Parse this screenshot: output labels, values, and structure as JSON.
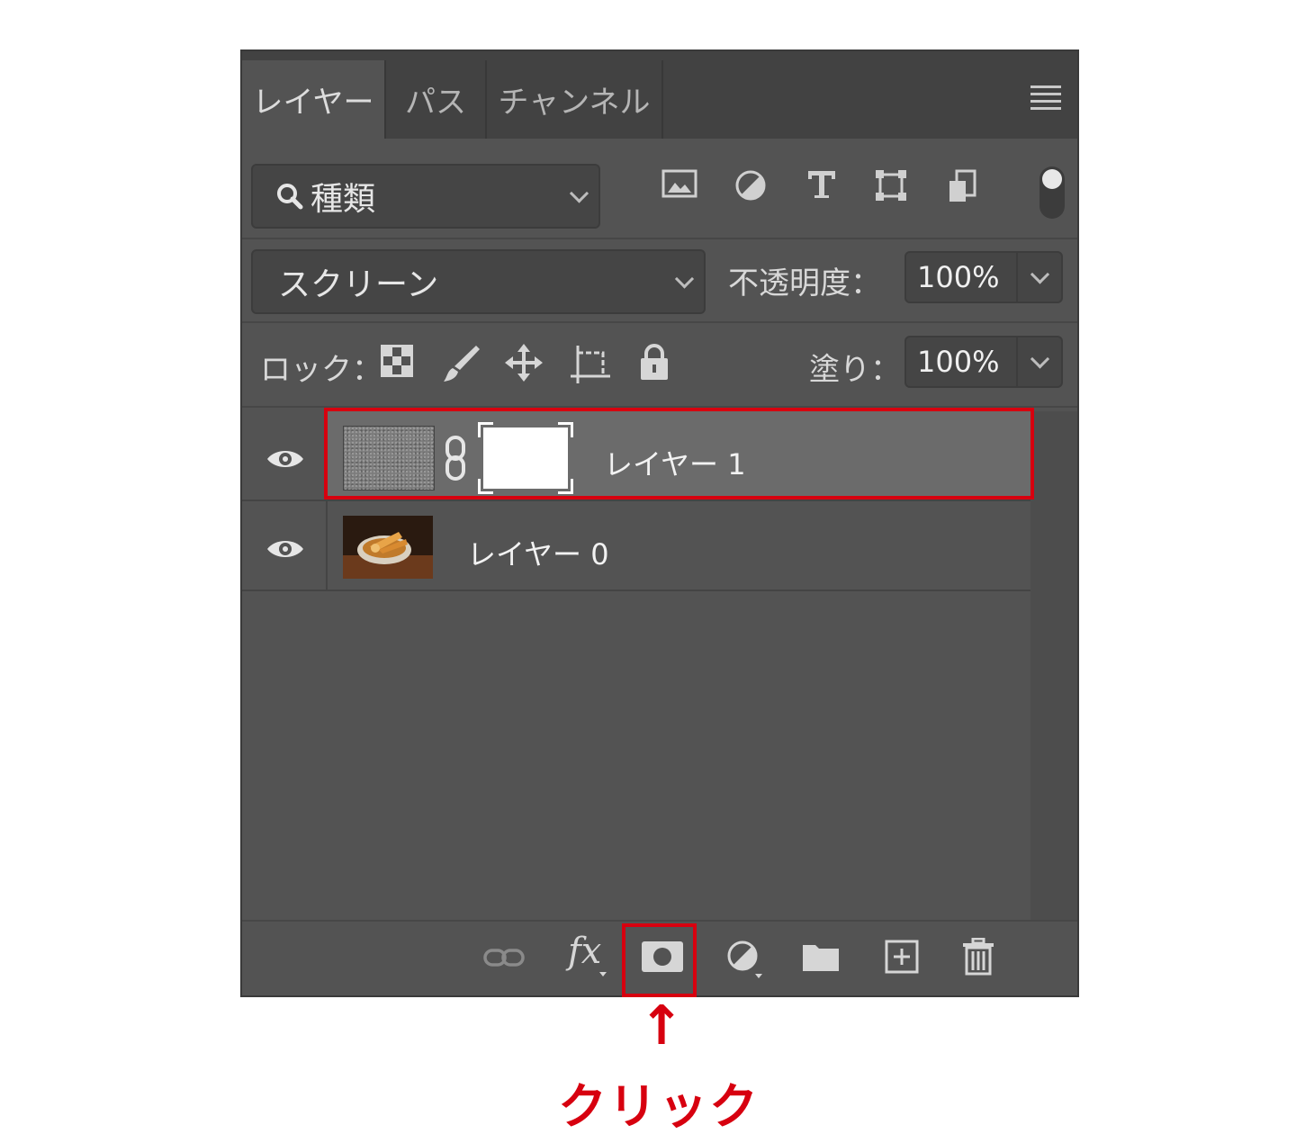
{
  "tabs": [
    {
      "label": "レイヤー",
      "active": true
    },
    {
      "label": "パス",
      "active": false
    },
    {
      "label": "チャンネル",
      "active": false
    }
  ],
  "filter": {
    "label": "種類"
  },
  "blend_mode": {
    "value": "スクリーン"
  },
  "opacity": {
    "label": "不透明度：",
    "value": "100%"
  },
  "lock": {
    "label": "ロック："
  },
  "fill": {
    "label": "塗り：",
    "value": "100%"
  },
  "layers": [
    {
      "name": "レイヤー 1",
      "selected": true,
      "has_mask": true
    },
    {
      "name": "レイヤー 0",
      "selected": false,
      "has_mask": false
    }
  ],
  "bottom_toolbar": {
    "fx_label": "fx",
    "icons": [
      "link-icon",
      "fx-icon",
      "add-mask-icon",
      "adjustment-layer-icon",
      "group-folder-icon",
      "new-layer-icon",
      "trash-icon"
    ]
  },
  "annotation": {
    "arrow": "↑",
    "text": "クリック"
  },
  "colors": {
    "highlight": "#d7000f",
    "panel": "#535353"
  }
}
